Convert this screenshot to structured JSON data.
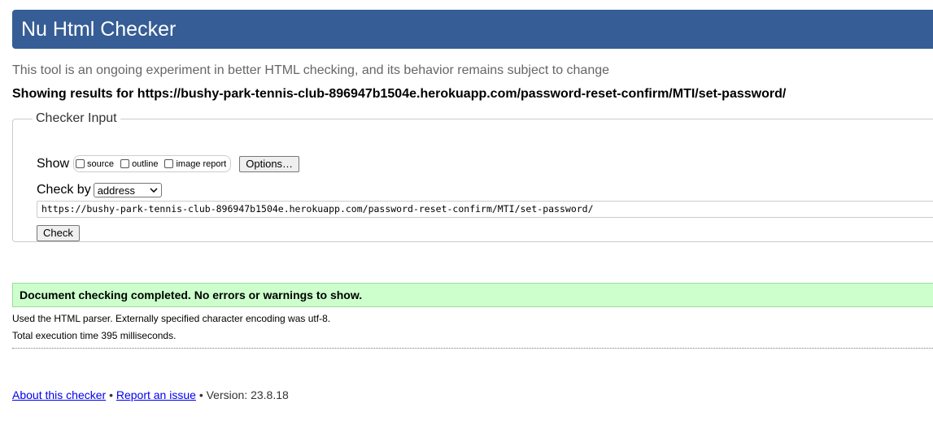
{
  "header": {
    "title": "Nu Html Checker"
  },
  "intro": "This tool is an ongoing experiment in better HTML checking, and its behavior remains subject to change",
  "results_heading": "Showing results for https://bushy-park-tennis-club-896947b1504e.herokuapp.com/password-reset-confirm/MTI/set-password/",
  "checker_input": {
    "legend": "Checker Input",
    "show_label": "Show",
    "options": [
      {
        "label": "source",
        "checked": false
      },
      {
        "label": "outline",
        "checked": false
      },
      {
        "label": "image report",
        "checked": false
      }
    ],
    "options_button": "Options…",
    "check_by_label": "Check by",
    "check_by_selected": "address",
    "url_value": "https://bushy-park-tennis-club-896947b1504e.herokuapp.com/password-reset-confirm/MTI/set-password/",
    "check_button": "Check"
  },
  "result": {
    "message": "Document checking completed. No errors or warnings to show.",
    "success_color": "#ccffcc"
  },
  "info": {
    "parser": "Used the HTML parser. Externally specified character encoding was utf-8.",
    "time": "Total execution time 395 milliseconds."
  },
  "footer": {
    "about_link": "About this checker",
    "separator": "•",
    "report_link": "Report an issue",
    "version": "Version: 23.8.18"
  },
  "colors": {
    "header_bg": "#365d95",
    "link": "#0000ee"
  }
}
